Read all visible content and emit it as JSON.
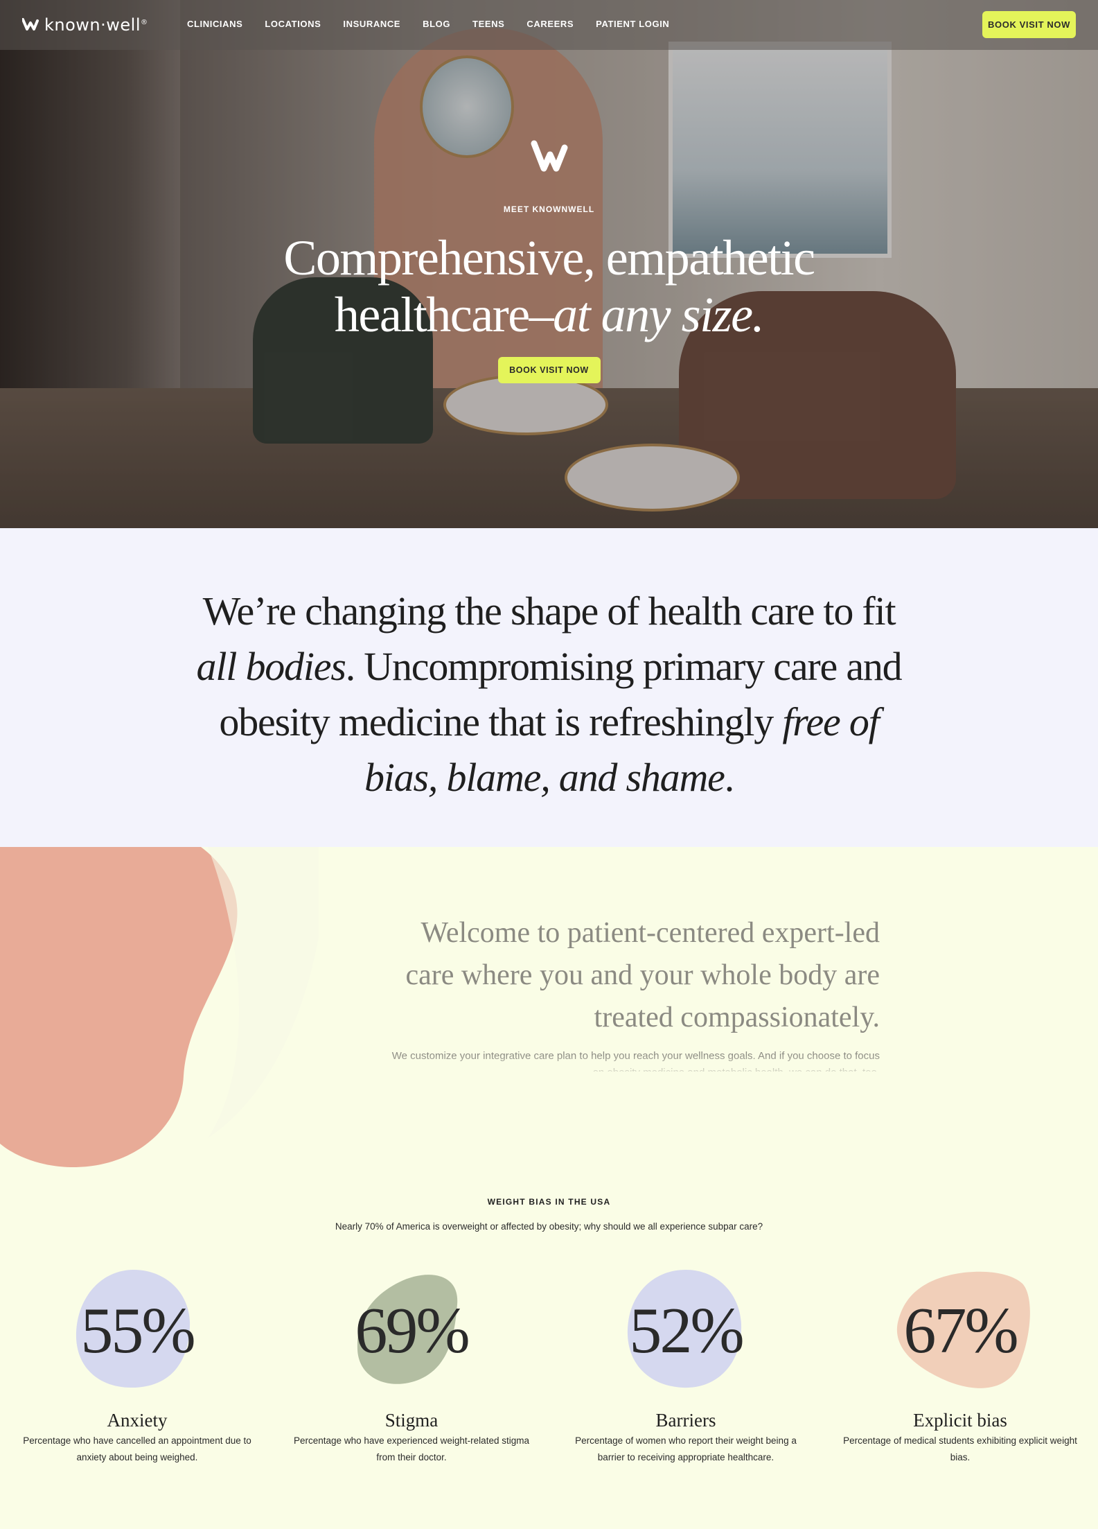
{
  "brand": {
    "name": "known·well",
    "registered": "®"
  },
  "nav": {
    "links": [
      "CLINICIANS",
      "LOCATIONS",
      "INSURANCE",
      "BLOG",
      "TEENS",
      "CAREERS",
      "PATIENT LOGIN"
    ],
    "cta": "BOOK VISIT NOW"
  },
  "hero": {
    "eyebrow": "MEET KNOWNWELL",
    "title_line1": "Comprehensive, empathetic",
    "title_line2_plain": "healthcare–",
    "title_line2_italic": "at any size.",
    "cta": "BOOK VISIT NOW"
  },
  "mission": {
    "p1": "We’re changing the shape of health care to fit ",
    "p1_em": "all bodies",
    "p2": ". Uncompromising primary care and obesity medicine that is refreshingly ",
    "p2_em": "free of bias, blame, and shame",
    "p3": "."
  },
  "welcome": {
    "heading": "Welcome to patient-centered expert-led care where you and your whole body are treated compassionately.",
    "body": "We customize your integrative care plan to help you reach your wellness goals. And if you choose to focus on obesity medicine and metabolic health, we can do that, too."
  },
  "stats_section": {
    "eyebrow": "WEIGHT BIAS IN THE USA",
    "subtitle": "Nearly 70% of America is overweight or affected by obesity; why should we all experience subpar care?",
    "items": [
      {
        "value": "55%",
        "title": "Anxiety",
        "desc": "Percentage who have cancelled an appointment due to anxiety about being weighed.",
        "color": "#d5d8ef"
      },
      {
        "value": "69%",
        "title": "Stigma",
        "desc": "Percentage who have experienced weight-related stigma from their doctor.",
        "color": "#b3bea2"
      },
      {
        "value": "52%",
        "title": "Barriers",
        "desc": "Percentage of women who report their weight being a barrier to receiving appropriate healthcare.",
        "color": "#d5d8ef"
      },
      {
        "value": "67%",
        "title": "Explicit bias",
        "desc": "Percentage of medical students exhibiting explicit weight bias.",
        "color": "#f1cfb9"
      }
    ]
  },
  "colors": {
    "lime": "#e4f45a",
    "terracotta": "#e8ab97",
    "lavender_bg": "#f3f3fc",
    "cream_bg": "#fafde6"
  }
}
